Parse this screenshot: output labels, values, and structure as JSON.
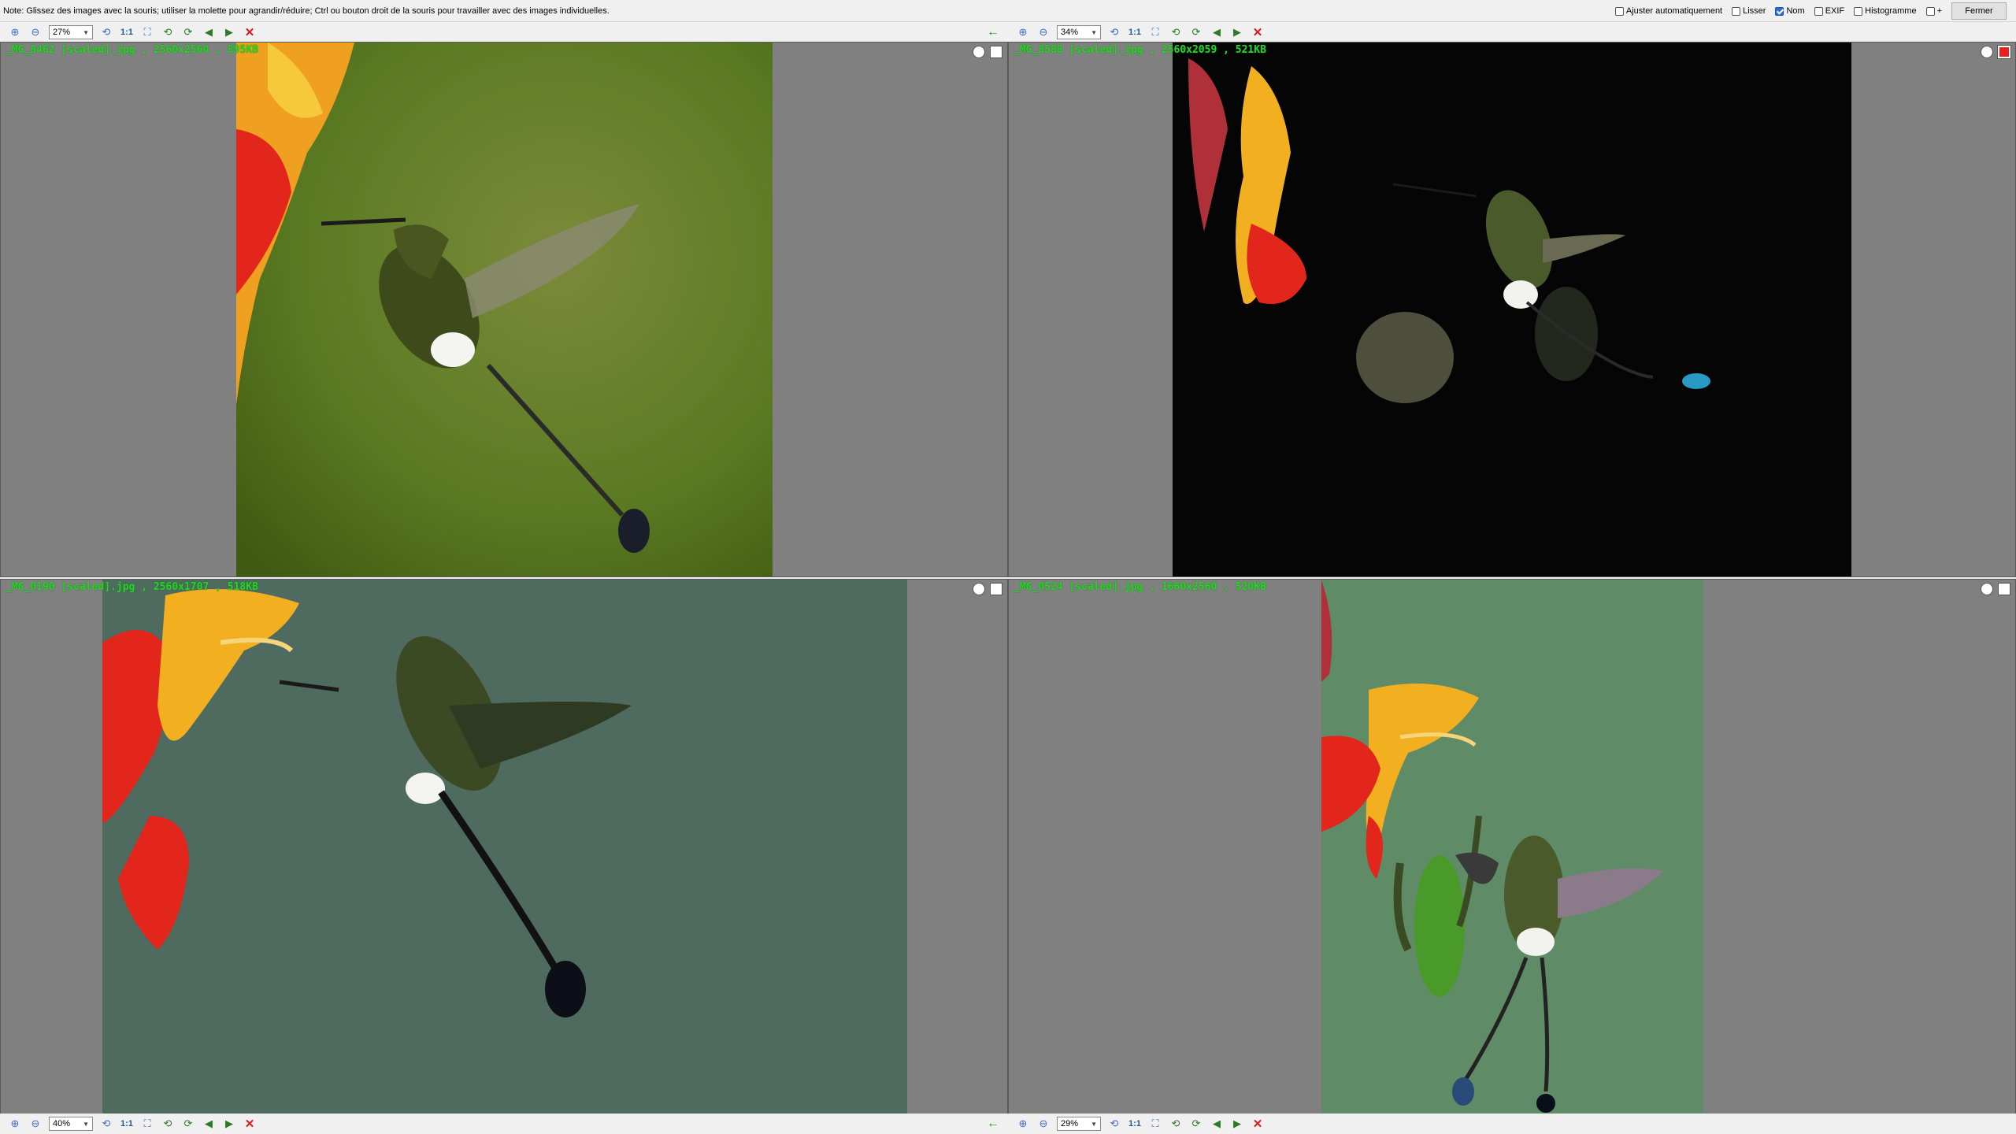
{
  "note": "Note: Glissez des images avec la souris; utiliser la molette pour agrandir/réduire; Ctrl ou bouton droit de la souris pour travailler avec des images individuelles.",
  "options": {
    "auto_fit": "Ajuster automatiquement",
    "smooth": "Lisser",
    "name": "Nom",
    "exif": "EXIF",
    "histogram": "Histogramme",
    "plus": "+",
    "close": "Fermer"
  },
  "toolbar_one_label": "1:1",
  "panes": [
    {
      "zoom": "27%",
      "info": "_MG_8462 [scaled].jpg , 2560x2560 , 895KB"
    },
    {
      "zoom": "34%",
      "info": "_MG_8588 [scaled].jpg , 2560x2059 , 521KB"
    },
    {
      "zoom": "40%",
      "info": "_MG_0190 [scaled].jpg , 2560x1707 , 518KB"
    },
    {
      "zoom": "29%",
      "info": "_MG_0524 [scaled].jpg , 1660x2560 , 520KB"
    }
  ],
  "colors": {
    "bg_green_1": "#6b8a2a",
    "bg_black_2": "#050505",
    "bg_teal_3": "#4f6a5e",
    "bg_green_4": "#5f8c66",
    "info_text": "#23d823"
  }
}
